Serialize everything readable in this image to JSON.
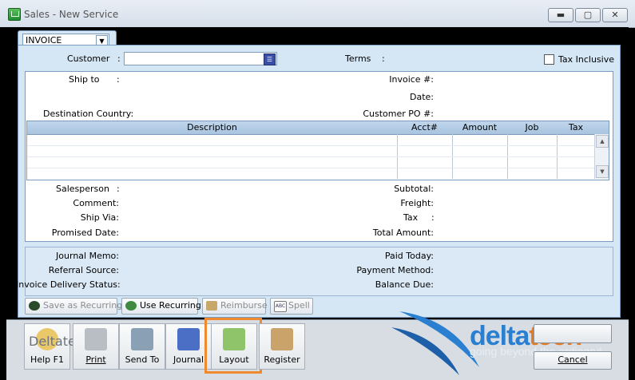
{
  "window": {
    "title": "Sales - New Service",
    "minimize": "▬",
    "maximize": "▢",
    "close": "✕"
  },
  "form": {
    "type_value": "INVOICE",
    "customer_label": "Customer",
    "terms_label": "Terms",
    "tax_inclusive_label": "Tax Inclusive",
    "tax_inclusive_checked": false,
    "ship_to_label": "Ship to",
    "destination_country_label": "Destination Country:",
    "invoice_no_label": "Invoice #:",
    "date_label": "Date:",
    "customer_po_label": "Customer PO #:",
    "grid": {
      "columns": [
        "Description",
        "Acct#",
        "Amount",
        "Job",
        "Tax"
      ]
    },
    "salesperson_label": "Salesperson",
    "comment_label": "Comment:",
    "ship_via_label": "Ship Via:",
    "promised_date_label": "Promised Date:",
    "subtotal_label": "Subtotal:",
    "freight_label": "Freight:",
    "tax_label": "Tax",
    "total_amount_label": "Total Amount:",
    "journal_memo_label": "Journal Memo:",
    "referral_source_label": "Referral Source:",
    "invoice_delivery_status_label": "Invoice Delivery Status:",
    "paid_today_label": "Paid Today:",
    "payment_method_label": "Payment Method:",
    "balance_due_label": "Balance Due:"
  },
  "form_toolbar": {
    "save_as_recurring": "Save as Recurring",
    "use_recurring": "Use Recurring",
    "reimburse": "Reimburse",
    "spell": "Spell"
  },
  "bottom_toolbar": {
    "help": "Help F1",
    "print": "Print",
    "send_to": "Send To",
    "journal": "Journal",
    "layout": "Layout",
    "register": "Register",
    "cancel": "Cancel"
  },
  "branding": {
    "word_a": "delta",
    "word_b": "tech",
    "tagline": "going beyond the ordinary!",
    "watermark": "Deltatech"
  },
  "colors": {
    "highlight": "#ef8a2f",
    "form_bg": "#d5e6f5",
    "brand_blue": "#2a7fd0",
    "brand_orange": "#e67a20"
  }
}
